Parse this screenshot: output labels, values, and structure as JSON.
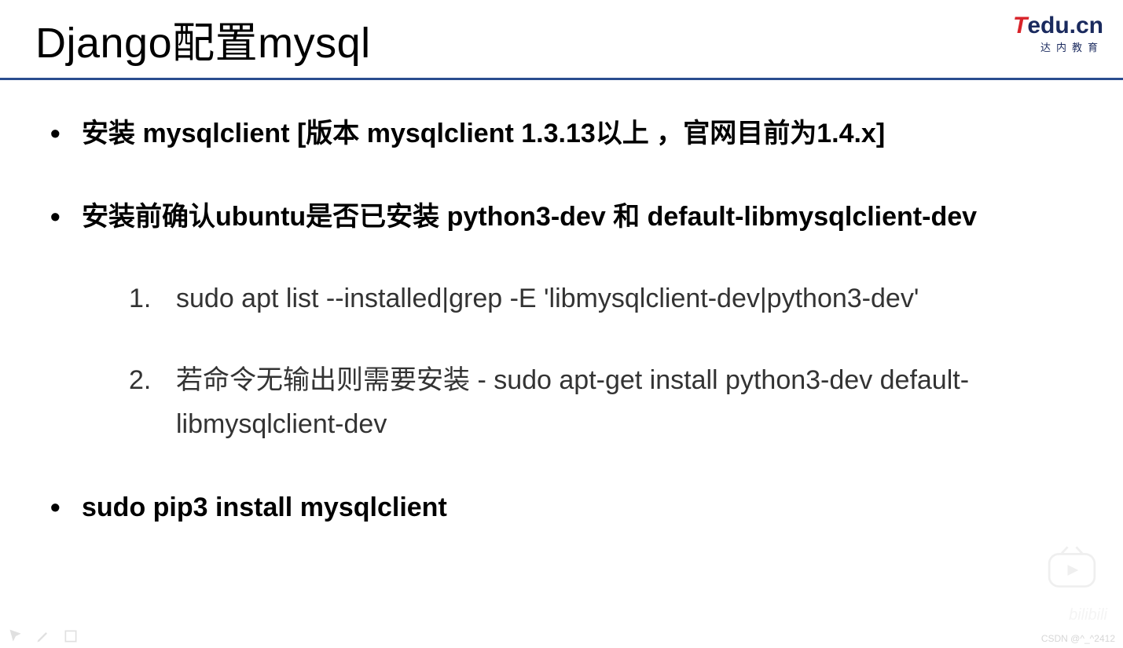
{
  "header": {
    "title": "Django配置mysql",
    "logo_brand_t": "T",
    "logo_brand_rest": "edu.cn",
    "logo_subtitle": "达内教育"
  },
  "bullets": [
    {
      "text": "安装 mysqlclient [版本 mysqlclient 1.3.13以上 ，官网目前为1.4.x]",
      "steps": []
    },
    {
      "text": "安装前确认ubuntu是否已安装 python3-dev 和  default-libmysqlclient-dev",
      "steps": [
        "sudo apt list --installed|grep -E 'libmysqlclient-dev|python3-dev'",
        "若命令无输出则需要安装 -  sudo apt-get install python3-dev default-libmysqlclient-dev"
      ]
    },
    {
      "text": "sudo pip3 install mysqlclient",
      "steps": []
    }
  ],
  "watermark": {
    "csdn": "CSDN @^_^2412",
    "bilibili": "bilibili"
  }
}
